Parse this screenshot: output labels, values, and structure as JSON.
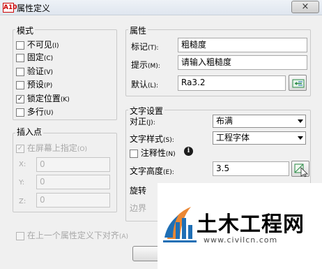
{
  "window": {
    "title": "属性定义",
    "app_icon_label": "A10",
    "close_glyph": "×"
  },
  "mode": {
    "title": "模式",
    "options": [
      {
        "label": "不可见",
        "shortcut": "(I)",
        "checked": false
      },
      {
        "label": "固定",
        "shortcut": "(C)",
        "checked": false
      },
      {
        "label": "验证",
        "shortcut": "(V)",
        "checked": false
      },
      {
        "label": "预设",
        "shortcut": "(P)",
        "checked": false
      },
      {
        "label": "锁定位置",
        "shortcut": "(K)",
        "checked": true
      },
      {
        "label": "多行",
        "shortcut": "(U)",
        "checked": false
      }
    ]
  },
  "insertion_point": {
    "title": "插入点",
    "specify_on_screen": {
      "label": "在屏幕上指定",
      "shortcut": "(O)",
      "checked": true,
      "enabled": false
    },
    "x": {
      "label": "X:",
      "value": "0"
    },
    "y": {
      "label": "Y:",
      "value": "0"
    },
    "z": {
      "label": "Z:",
      "value": "0"
    }
  },
  "align_below": {
    "label": "在上一个属性定义下对齐",
    "shortcut": "(A)",
    "checked": false
  },
  "attribute": {
    "title": "属性",
    "tag": {
      "label": "标记",
      "shortcut": "(T):",
      "value": "粗糙度"
    },
    "prompt": {
      "label": "提示",
      "shortcut": "(M):",
      "value": "请输入粗糙度"
    },
    "default": {
      "label": "默认",
      "shortcut": "(L):",
      "value": "Ra3.2"
    }
  },
  "text_settings": {
    "title": "文字设置",
    "justify": {
      "label": "对正",
      "shortcut": "(J):",
      "value": "布满"
    },
    "style": {
      "label": "文字样式",
      "shortcut": "(S):",
      "value": "工程字体"
    },
    "annotative": {
      "label": "注释性",
      "shortcut": "(N)",
      "checked": false
    },
    "height": {
      "label": "文字高度",
      "shortcut": "(E):",
      "value": "3.5"
    },
    "rotation": {
      "label": "旋转"
    },
    "boundary": {
      "label": "边界"
    }
  },
  "watermark": {
    "title": "土木工程网",
    "url": "www.civilcn.com"
  },
  "colors": {
    "accent_blue": "#1f6fb5",
    "checked_mark": "#1a1a1a",
    "watermark_orange": "#e87a1e"
  }
}
